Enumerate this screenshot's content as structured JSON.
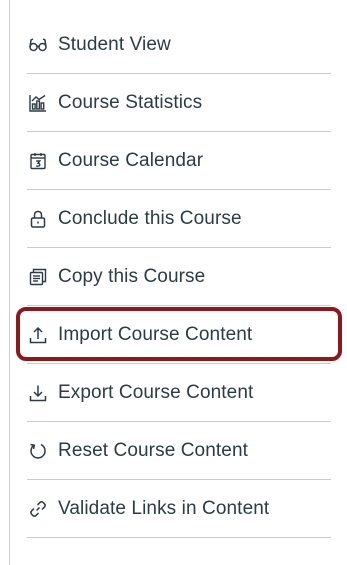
{
  "menu": {
    "items": [
      {
        "label": "Student View",
        "icon": "glasses-icon"
      },
      {
        "label": "Course Statistics",
        "icon": "statistics-icon"
      },
      {
        "label": "Course Calendar",
        "icon": "calendar-icon"
      },
      {
        "label": "Conclude this Course",
        "icon": "lock-icon"
      },
      {
        "label": "Copy this Course",
        "icon": "copy-icon"
      },
      {
        "label": "Import Course Content",
        "icon": "upload-icon",
        "highlighted": true
      },
      {
        "label": "Export Course Content",
        "icon": "download-icon"
      },
      {
        "label": "Reset Course Content",
        "icon": "reset-icon"
      },
      {
        "label": "Validate Links in Content",
        "icon": "link-icon"
      }
    ]
  },
  "colors": {
    "text": "#2d3b45",
    "divider": "#c7cdd1",
    "highlight_border": "#8b1a1f"
  }
}
